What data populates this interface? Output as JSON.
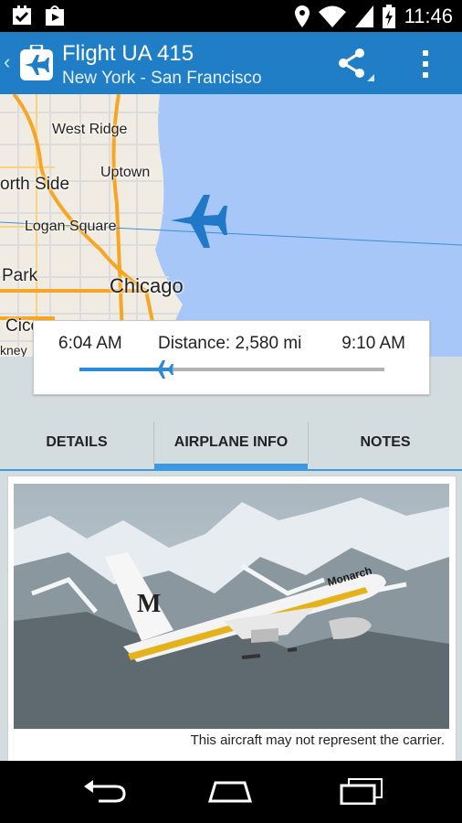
{
  "status_bar": {
    "time": "11:46"
  },
  "action_bar": {
    "title": "Flight UA 415",
    "subtitle": "New York - San Francisco"
  },
  "map": {
    "labels": {
      "west_ridge": "West Ridge",
      "uptown": "Uptown",
      "north_side": "orth Side",
      "logan_square": "Logan Square",
      "park": "Park",
      "chicago": "Chicago",
      "cicero": "Cice",
      "kney": "kney"
    }
  },
  "flight_progress": {
    "departure_time": "6:04 AM",
    "distance": "Distance: 2,580 mi",
    "arrival_time": "9:10 AM",
    "progress": 0.27
  },
  "tabs": [
    {
      "label": "DETAILS",
      "active": false
    },
    {
      "label": "AIRPLANE INFO",
      "active": true
    },
    {
      "label": "NOTES",
      "active": false
    }
  ],
  "airplane_info": {
    "caption": "This aircraft may not represent the carrier.",
    "livery_text": "Monarch"
  },
  "colors": {
    "action_bar": "#1f7ec5",
    "accent": "#3a99e0",
    "water": "#a6c7f7"
  }
}
